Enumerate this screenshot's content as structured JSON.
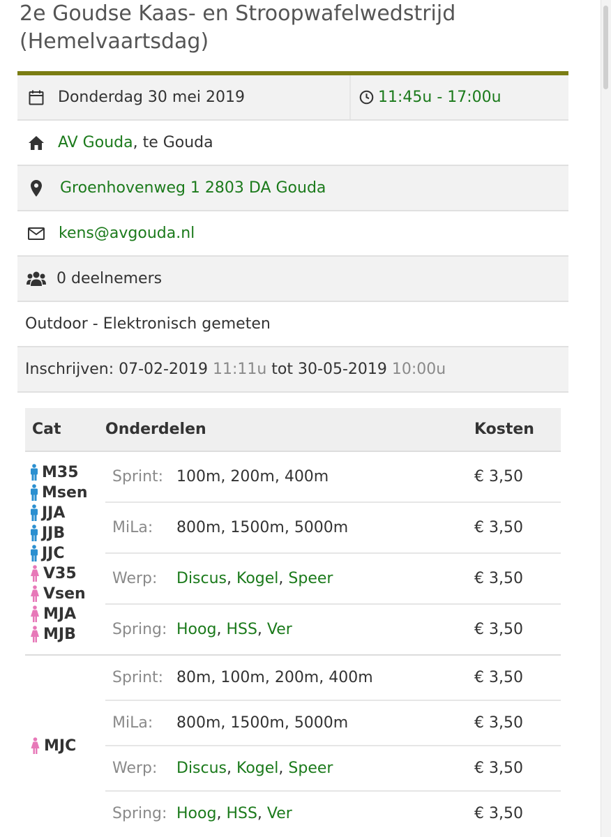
{
  "event": {
    "title_line1": "2e Goudse Kaas- en Stroopwafelwedstrijd",
    "title_line2": "(Hemelvaartsdag)",
    "date": "Donderdag 30 mei 2019",
    "time": "11:45u - 17:00u",
    "club_link": "AV Gouda",
    "club_suffix": ", te Gouda",
    "address": "Groenhovenweg 1 2803 DA Gouda",
    "email": "kens@avgouda.nl",
    "participants": "0 deelnemers",
    "type": "Outdoor - Elektronisch gemeten",
    "registration": {
      "label": "Inschrijven: ",
      "start_date": "07-02-2019",
      "start_time": "11:11u",
      "sep": " tot ",
      "end_date": "30-05-2019",
      "end_time": "10:00u"
    }
  },
  "colors": {
    "accent_bar": "#7b7d13",
    "link_green": "#1b7a1b",
    "male_icon": "#2a8fd0",
    "female_icon": "#e778b8"
  },
  "icons": [
    "calendar-icon",
    "clock-icon",
    "home-icon",
    "map-marker-icon",
    "envelope-icon",
    "users-icon",
    "male-icon",
    "female-icon"
  ],
  "table": {
    "headers": {
      "cat": "Cat",
      "events": "Onderdelen",
      "cost": "Kosten"
    },
    "group1": {
      "categories": [
        {
          "name": "M35",
          "gender": "male"
        },
        {
          "name": "Msen",
          "gender": "male"
        },
        {
          "name": "JJA",
          "gender": "male"
        },
        {
          "name": "JJB",
          "gender": "male"
        },
        {
          "name": "JJC",
          "gender": "male"
        },
        {
          "name": "V35",
          "gender": "female"
        },
        {
          "name": "Vsen",
          "gender": "female"
        },
        {
          "name": "MJA",
          "gender": "female"
        },
        {
          "name": "MJB",
          "gender": "female"
        }
      ],
      "rows": [
        {
          "label": "Sprint:",
          "events": "100m, 200m, 400m",
          "cost": "€ 3,50"
        },
        {
          "label": "MiLa:",
          "events": "800m, 1500m, 5000m",
          "cost": "€ 3,50"
        },
        {
          "label": "Werp:",
          "e1": "Discus",
          "e2": "Kogel",
          "e3": "Speer",
          "cost": "€ 3,50"
        },
        {
          "label": "Spring:",
          "e1": "Hoog",
          "e2": "HSS",
          "e3": "Ver",
          "cost": "€ 3,50"
        }
      ]
    },
    "group2": {
      "category": {
        "name": "MJC",
        "gender": "female"
      },
      "rows": [
        {
          "label": "Sprint:",
          "events": "80m, 100m, 200m, 400m",
          "cost": "€ 3,50"
        },
        {
          "label": "MiLa:",
          "events": "800m, 1500m, 5000m",
          "cost": "€ 3,50"
        },
        {
          "label": "Werp:",
          "e1": "Discus",
          "e2": "Kogel",
          "e3": "Speer",
          "cost": "€ 3,50"
        },
        {
          "label": "Spring:",
          "e1": "Hoog",
          "e2": "HSS",
          "e3": "Ver",
          "cost": "€ 3,50"
        }
      ]
    },
    "comma": ", "
  }
}
